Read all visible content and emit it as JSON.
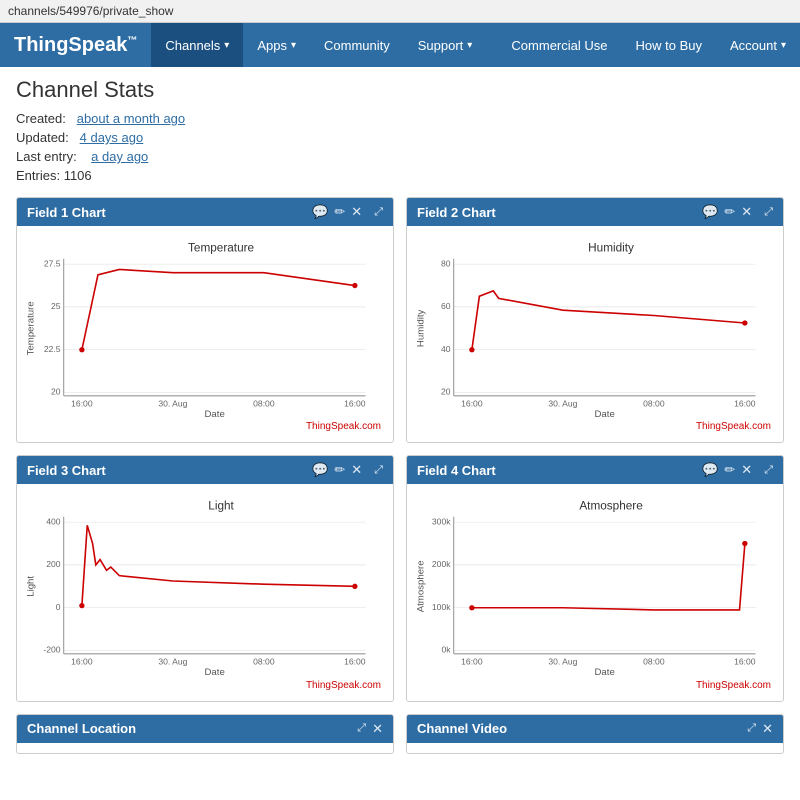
{
  "browser": {
    "url": "channels/549976/private_show"
  },
  "navbar": {
    "brand": "ThingSpeak",
    "brand_tm": "™",
    "items_left": [
      {
        "label": "Channels",
        "has_caret": true,
        "active": false
      },
      {
        "label": "Apps",
        "has_caret": true,
        "active": false
      },
      {
        "label": "Community",
        "has_caret": false,
        "active": false
      },
      {
        "label": "Support",
        "has_caret": true,
        "active": false
      }
    ],
    "items_right": [
      {
        "label": "Commercial Use",
        "has_caret": false
      },
      {
        "label": "How to Buy",
        "has_caret": false
      },
      {
        "label": "Account",
        "has_caret": true
      }
    ]
  },
  "page": {
    "title": "Channel Stats",
    "stats": [
      {
        "label": "Created:",
        "value": "about a month ago"
      },
      {
        "label": "Updated:",
        "value": "4 days ago"
      },
      {
        "label": "Last entry:",
        "value": "a day ago"
      },
      {
        "label": "Entries:",
        "value": "1106"
      }
    ]
  },
  "charts": [
    {
      "id": "field1",
      "title": "Field 1 Chart",
      "chart_title": "Temperature",
      "y_label": "Temperature",
      "x_label": "Date",
      "credit": "ThingSpeak.com",
      "y_min": 20,
      "y_max": 27.5,
      "y_ticks": [
        "27.5",
        "25",
        "22.5",
        "20"
      ],
      "x_ticks": [
        "16:00",
        "30. Aug",
        "08:00",
        "16:00"
      ]
    },
    {
      "id": "field2",
      "title": "Field 2 Chart",
      "chart_title": "Humidity",
      "y_label": "Humidity",
      "x_label": "Date",
      "credit": "ThingSpeak.com",
      "y_min": 20,
      "y_max": 80,
      "y_ticks": [
        "80",
        "60",
        "40",
        "20"
      ],
      "x_ticks": [
        "16:00",
        "30. Aug",
        "08:00",
        "16:00"
      ]
    },
    {
      "id": "field3",
      "title": "Field 3 Chart",
      "chart_title": "Light",
      "y_label": "Light",
      "x_label": "Date",
      "credit": "ThingSpeak.com",
      "y_min": -200,
      "y_max": 400,
      "y_ticks": [
        "400",
        "200",
        "0",
        "-200"
      ],
      "x_ticks": [
        "16:00",
        "30. Aug",
        "08:00",
        "16:00"
      ]
    },
    {
      "id": "field4",
      "title": "Field 4 Chart",
      "chart_title": "Atmosphere",
      "y_label": "Atmosphere",
      "x_label": "Date",
      "credit": "ThingSpeak.com",
      "y_min": 0,
      "y_max": 300000,
      "y_ticks": [
        "300k",
        "200k",
        "100k",
        "0k"
      ],
      "x_ticks": [
        "16:00",
        "30. Aug",
        "08:00",
        "16:00"
      ]
    }
  ],
  "bottom_cards": [
    {
      "title": "Channel Location"
    },
    {
      "title": "Channel Video"
    }
  ],
  "icons": {
    "comment": "💬",
    "edit": "✏",
    "close": "✕",
    "expand": "⤢"
  }
}
